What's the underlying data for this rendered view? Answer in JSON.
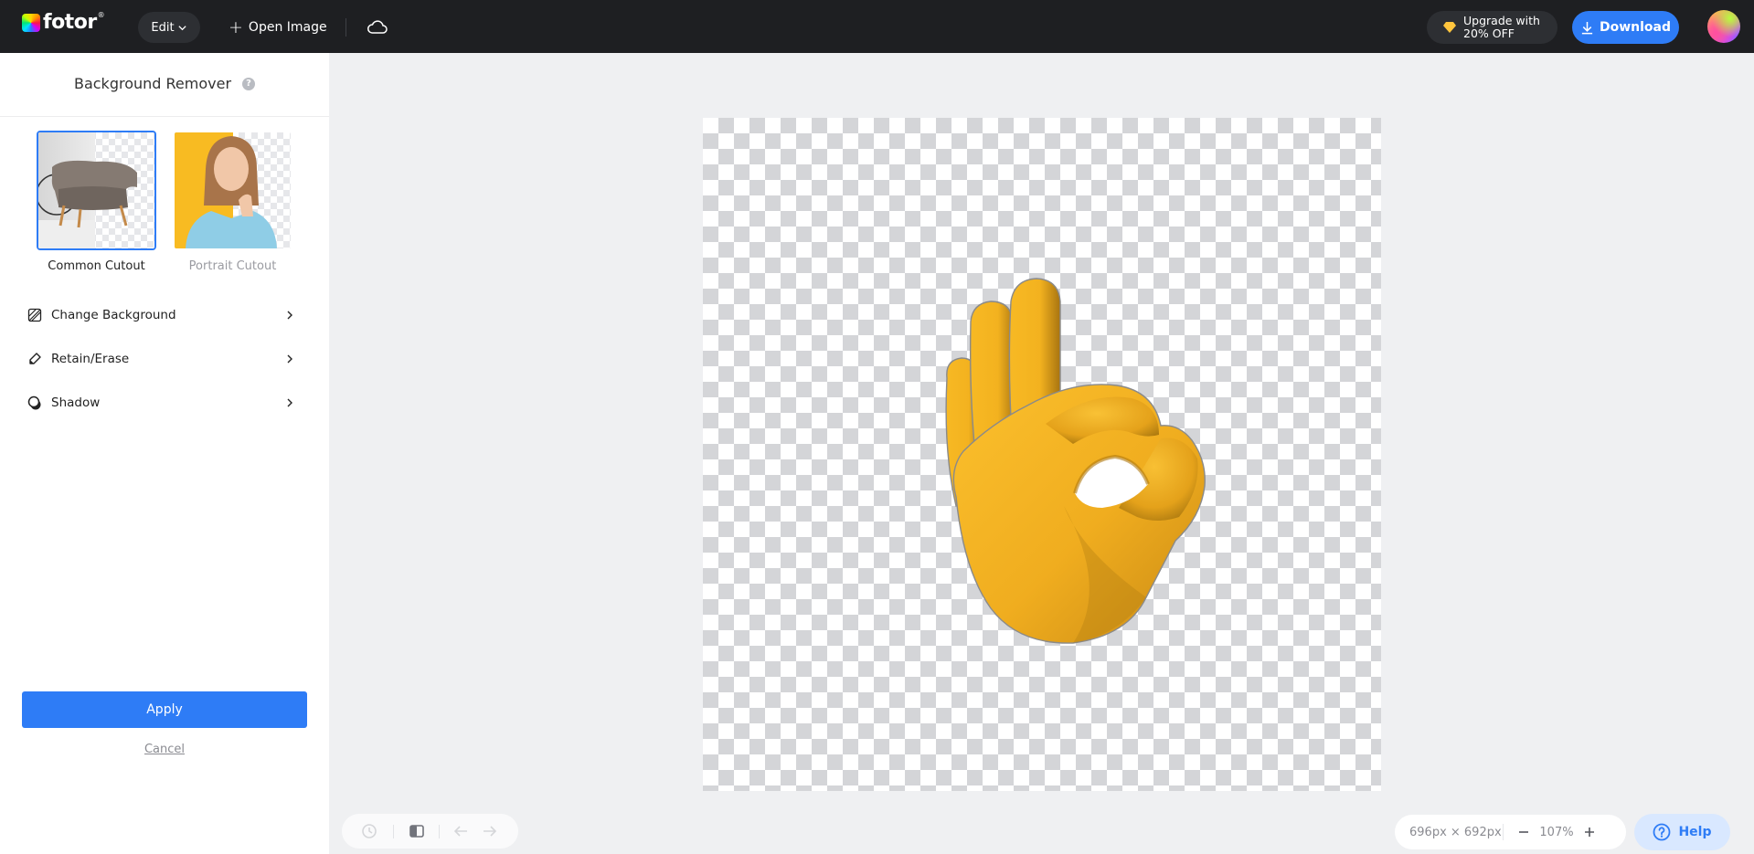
{
  "header": {
    "logo_text": "fotor",
    "logo_mark": "®",
    "edit_label": "Edit",
    "open_image_label": "Open Image",
    "upgrade_line1": "Upgrade with",
    "upgrade_line2": "20% OFF",
    "download_label": "Download",
    "icons": [
      "fotor-logo-icon",
      "chevron-down-icon",
      "plus-icon",
      "cloud-icon",
      "diamond-icon",
      "download-icon",
      "avatar"
    ]
  },
  "sidebar": {
    "title": "Background Remover",
    "help_glyph": "?",
    "cutouts": [
      {
        "label": "Common Cutout",
        "selected": true,
        "preview": "armchair"
      },
      {
        "label": "Portrait Cutout",
        "selected": false,
        "preview": "woman-thinking"
      }
    ],
    "menu": [
      {
        "label": "Change Background",
        "icon": "background-icon"
      },
      {
        "label": "Retain/Erase",
        "icon": "eraser-icon"
      },
      {
        "label": "Shadow",
        "icon": "shadow-icon"
      }
    ],
    "apply_label": "Apply",
    "cancel_label": "Cancel"
  },
  "canvas": {
    "subject": "ok-hand-emoji",
    "background": "transparent"
  },
  "history_bar": {
    "icons": [
      "history-icon",
      "compare-icon",
      "undo-icon",
      "redo-icon"
    ]
  },
  "zoom_bar": {
    "dimensions": "696px × 692px",
    "zoom_level": "107%",
    "minus": "−",
    "plus": "+"
  },
  "help": {
    "label": "Help"
  },
  "colors": {
    "accent": "#2e7cf6",
    "header_bg": "#1e1f22",
    "workspace_bg": "#eff0f2",
    "hand_yellow": "#f4b829"
  }
}
